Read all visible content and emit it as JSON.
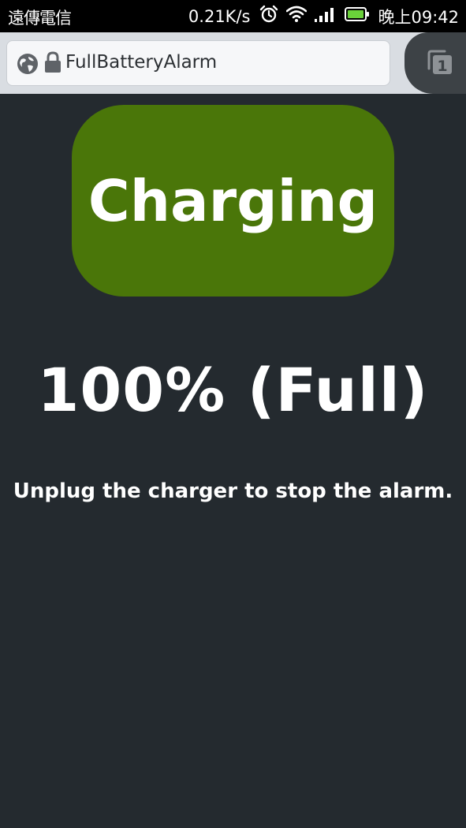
{
  "status_bar": {
    "carrier": "遠傳電信",
    "net_speed": "0.21K/s",
    "clock": "晚上09:42",
    "icons": [
      "alarm-clock-icon",
      "wifi-icon",
      "signal-icon",
      "battery-icon"
    ],
    "battery_color": "#6ad13a"
  },
  "browser": {
    "url": "FullBatteryAlarm",
    "tab_count": "1",
    "icons": [
      "globe-icon",
      "lock-icon",
      "tabs-icon"
    ]
  },
  "page": {
    "status_button_label": "Charging",
    "status_button_color": "#4a7609",
    "battery_level_text": "100% (Full)",
    "instruction": "Unplug the charger to stop the alarm.",
    "background_color": "#242a2f"
  }
}
